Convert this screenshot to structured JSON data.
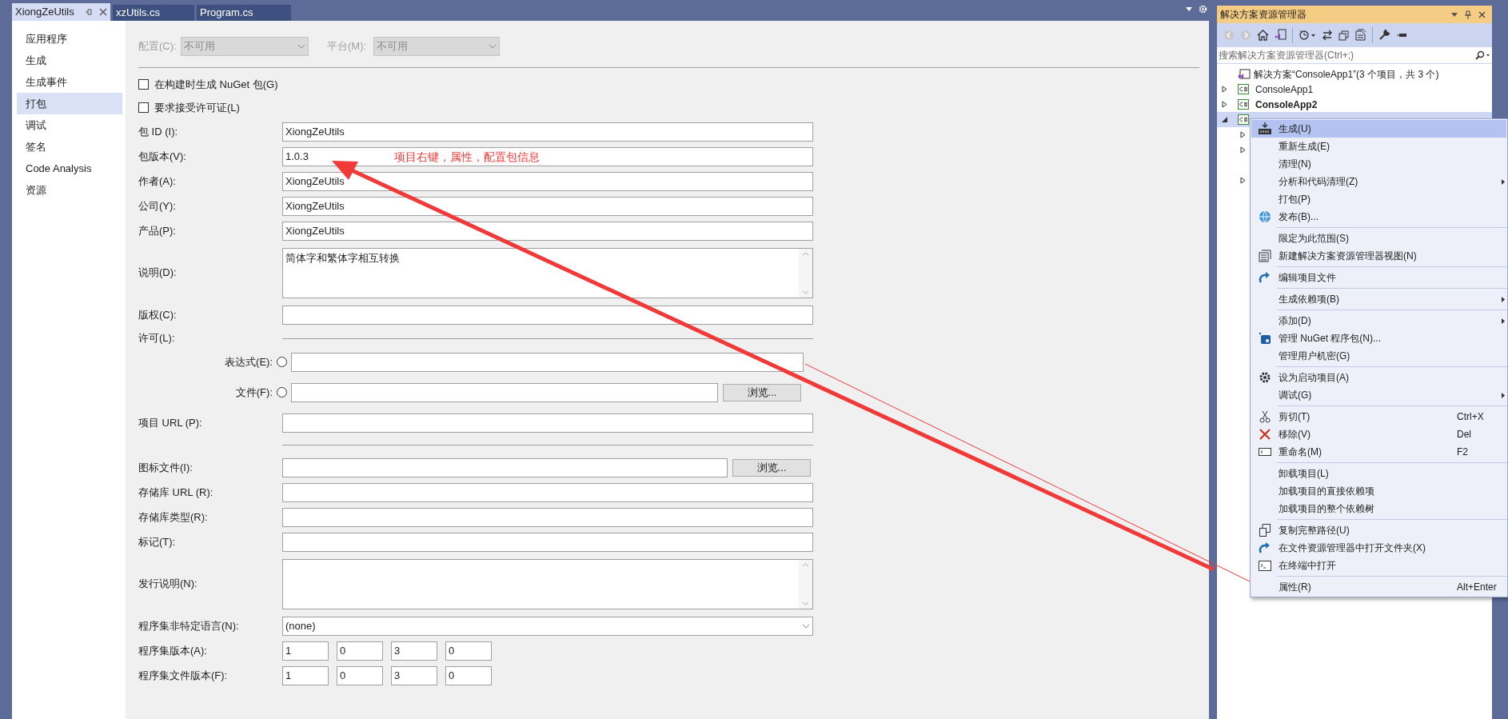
{
  "document_tabs": [
    {
      "label": "XiongZeUtils",
      "selected": true
    },
    {
      "label": "xzUtils.cs",
      "selected": false
    },
    {
      "label": "Program.cs",
      "selected": false
    }
  ],
  "nav": [
    {
      "label": "应用程序",
      "selected": false
    },
    {
      "label": "生成",
      "selected": false
    },
    {
      "label": "生成事件",
      "selected": false
    },
    {
      "label": "打包",
      "selected": true
    },
    {
      "label": "调试",
      "selected": false
    },
    {
      "label": "签名",
      "selected": false
    },
    {
      "label": "Code Analysis",
      "selected": false
    },
    {
      "label": "资源",
      "selected": false
    }
  ],
  "configuration": {
    "label": "配置(C):",
    "value": "不可用",
    "disabled": true
  },
  "platform": {
    "label": "平台(M):",
    "value": "不可用",
    "disabled": true
  },
  "checkboxes": [
    {
      "label": "在构建时生成 NuGet 包(G)",
      "checked": false
    },
    {
      "label": "要求接受许可证(L)",
      "checked": false
    }
  ],
  "fields": [
    {
      "kind": "text",
      "label": "包 ID (I):",
      "value": "XiongZeUtils"
    },
    {
      "kind": "text",
      "label": "包版本(V):",
      "value": "1.0.3"
    },
    {
      "kind": "text",
      "label": "作者(A):",
      "value": "XiongZeUtils"
    },
    {
      "kind": "text",
      "label": "公司(Y):",
      "value": "XiongZeUtils"
    },
    {
      "kind": "text",
      "label": "产品(P):",
      "value": "XiongZeUtils"
    },
    {
      "kind": "textarea",
      "label": "说明(D):",
      "value": "简体字和繁体字相互转换"
    },
    {
      "kind": "text",
      "label": "版权(C):"
    },
    {
      "kind": "section",
      "label": "许可(L):"
    },
    {
      "kind": "radio",
      "label": "表达式(E):",
      "selected": false
    },
    {
      "kind": "radio_browse",
      "label": "文件(F):",
      "selected": false,
      "button": "浏览..."
    },
    {
      "kind": "text",
      "label": "项目 URL (P):"
    },
    {
      "kind": "divider"
    },
    {
      "kind": "browse",
      "label": "图标文件(I):",
      "button": "浏览..."
    },
    {
      "kind": "text",
      "label": "存储库 URL (R):"
    },
    {
      "kind": "text",
      "label": "存储库类型(R):"
    },
    {
      "kind": "text",
      "label": "标记(T):"
    },
    {
      "kind": "textarea",
      "label": "发行说明(N):"
    },
    {
      "kind": "combo",
      "label": "程序集非特定语言(N):",
      "value": "(none)"
    },
    {
      "kind": "version",
      "label": "程序集版本(A):",
      "parts": [
        "1",
        "0",
        "3",
        "0"
      ]
    },
    {
      "kind": "version",
      "label": "程序集文件版本(F):",
      "parts": [
        "1",
        "0",
        "3",
        "0"
      ]
    }
  ],
  "annotation": {
    "text": "项目右键，属性，配置包信息"
  },
  "solution_explorer": {
    "title": "解决方案资源管理器",
    "search": {
      "placeholder": "搜索解决方案资源管理器(Ctrl+;)"
    },
    "tree": [
      {
        "kind": "solution",
        "label": "解决方案“ConsoleApp1”(3 个项目，共 3 个)",
        "children": [
          {
            "kind": "project",
            "label": "ConsoleApp1",
            "expanded": false,
            "selected": false
          },
          {
            "kind": "startup_project",
            "label": "ConsoleApp2",
            "expanded": false,
            "selected": false
          },
          {
            "kind": "project",
            "expanded": true,
            "selected": true,
            "children": [
              {
                "kind": "expandable_node"
              },
              {
                "kind": "expandable_node"
              },
              {
                "kind": "leaf_node"
              },
              {
                "kind": "expandable_node"
              }
            ]
          }
        ]
      }
    ]
  },
  "context_menu": [
    {
      "kind": "item",
      "label": "生成(U)",
      "highlighted": true
    },
    {
      "kind": "item",
      "label": "重新生成(E)",
      "highlighted": false
    },
    {
      "kind": "item",
      "label": "清理(N)",
      "highlighted": false
    },
    {
      "kind": "item",
      "label": "分析和代码清理(Z)",
      "submenu": true,
      "highlighted": false
    },
    {
      "kind": "item",
      "label": "打包(P)",
      "highlighted": false
    },
    {
      "kind": "item",
      "label": "发布(B)...",
      "highlighted": false
    },
    {
      "kind": "separator"
    },
    {
      "kind": "item",
      "label": "限定为此范围(S)",
      "highlighted": false
    },
    {
      "kind": "item",
      "label": "新建解决方案资源管理器视图(N)",
      "highlighted": false
    },
    {
      "kind": "separator"
    },
    {
      "kind": "item",
      "label": "编辑项目文件",
      "highlighted": false
    },
    {
      "kind": "separator"
    },
    {
      "kind": "item",
      "label": "生成依赖项(B)",
      "submenu": true,
      "highlighted": false
    },
    {
      "kind": "separator"
    },
    {
      "kind": "item",
      "label": "添加(D)",
      "submenu": true,
      "highlighted": false
    },
    {
      "kind": "item",
      "label": "管理 NuGet 程序包(N)...",
      "highlighted": false
    },
    {
      "kind": "item",
      "label": "管理用户机密(G)",
      "highlighted": false
    },
    {
      "kind": "separator"
    },
    {
      "kind": "item",
      "label": "设为启动项目(A)",
      "highlighted": false
    },
    {
      "kind": "item",
      "label": "调试(G)",
      "submenu": true,
      "highlighted": false
    },
    {
      "kind": "separator"
    },
    {
      "kind": "item",
      "label": "剪切(T)",
      "shortcut": "Ctrl+X",
      "highlighted": false
    },
    {
      "kind": "item",
      "label": "移除(V)",
      "shortcut": "Del",
      "highlighted": false
    },
    {
      "kind": "item",
      "label": "重命名(M)",
      "shortcut": "F2",
      "highlighted": false
    },
    {
      "kind": "separator"
    },
    {
      "kind": "item",
      "label": "卸载项目(L)",
      "highlighted": false
    },
    {
      "kind": "item",
      "label": "加载项目的直接依赖项",
      "highlighted": false
    },
    {
      "kind": "item",
      "label": "加载项目的整个依赖树",
      "highlighted": false
    },
    {
      "kind": "separator"
    },
    {
      "kind": "item",
      "label": "复制完整路径(U)",
      "highlighted": false
    },
    {
      "kind": "item",
      "label": "在文件资源管理器中打开文件夹(X)",
      "highlighted": false
    },
    {
      "kind": "item",
      "label": "在终端中打开",
      "highlighted": false
    },
    {
      "kind": "separator"
    },
    {
      "kind": "item",
      "label": "属性(R)",
      "shortcut": "Alt+Enter",
      "highlighted": false
    }
  ]
}
